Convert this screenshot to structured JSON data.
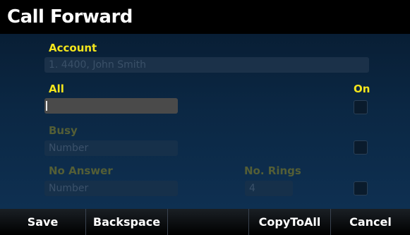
{
  "title": "Call Forward",
  "account": {
    "label": "Account",
    "value": "1. 4400, John Smith"
  },
  "on_label": "On",
  "rows": {
    "all": {
      "label": "All",
      "value": ""
    },
    "busy": {
      "label": "Busy",
      "placeholder": "Number"
    },
    "no_answer": {
      "label": "No Answer",
      "placeholder": "Number"
    }
  },
  "rings": {
    "label": "No. Rings",
    "value": "4"
  },
  "softkeys": [
    "Save",
    "Backspace",
    "",
    "CopyToAll",
    "Cancel"
  ],
  "colors": {
    "accent": "#f3e51c",
    "dim_label": "#545e36",
    "title_bar": "#000000"
  }
}
